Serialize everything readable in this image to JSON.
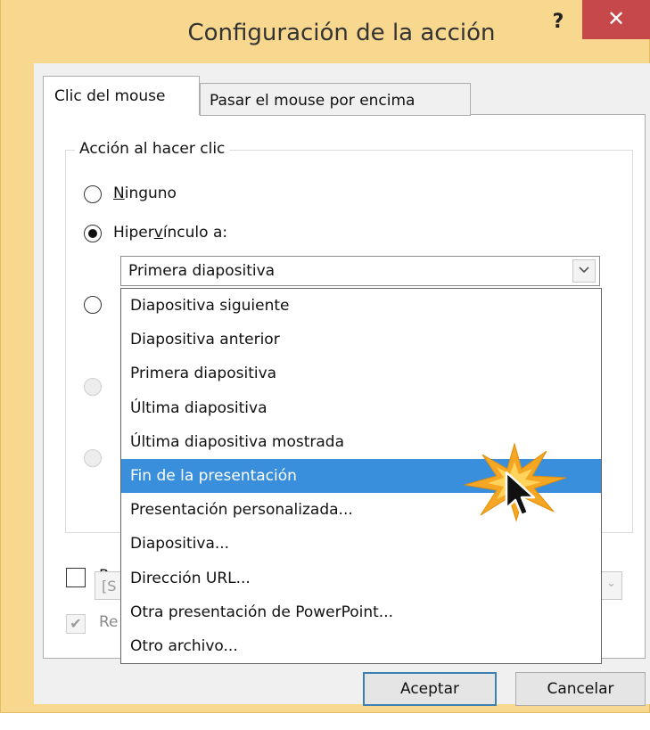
{
  "window": {
    "title": "Configuración de la acción",
    "help_label": "?",
    "close_label": "✕"
  },
  "tabs": [
    {
      "label": "Clic del mouse",
      "active": true
    },
    {
      "label": "Pasar el mouse por encima",
      "active": false
    }
  ],
  "group": {
    "label": "Acción al hacer clic",
    "options": [
      {
        "pre": "",
        "ul": "N",
        "post": "inguno",
        "checked": false,
        "enabled": true
      },
      {
        "pre": "Hiper",
        "ul": "v",
        "post": "ínculo a:",
        "checked": true,
        "enabled": true
      },
      {
        "checked": false,
        "enabled": true
      },
      {
        "checked": false,
        "enabled": false
      },
      {
        "checked": false,
        "enabled": false
      }
    ]
  },
  "hyperlink_combo": {
    "selected": "Primera diapositiva",
    "arrow_icon": "chevron-down-icon"
  },
  "dropdown": {
    "items": [
      "Diapositiva siguiente",
      "Diapositiva anterior",
      "Primera diapositiva",
      "Última diapositiva",
      "Última diapositiva mostrada",
      "Fin de la presentación",
      "Presentación personalizada...",
      "Diapositiva...",
      "Dirección URL...",
      "Otra presentación de PowerPoint...",
      "Otro archivo..."
    ],
    "highlighted_index": 5,
    "highlight_color": "#3a8fdd"
  },
  "behind_dropdown": {
    "sound_checkbox_label": "Re",
    "sound_field_text": "[S",
    "highlight_checkbox_label": "Re",
    "highlight_checked": true
  },
  "buttons": {
    "ok_label": "Aceptar",
    "cancel_label": "Cancelar"
  },
  "colors": {
    "window_frame": "#f8d78f",
    "close_button": "#c7484a",
    "click_burst": "#f5a623"
  }
}
